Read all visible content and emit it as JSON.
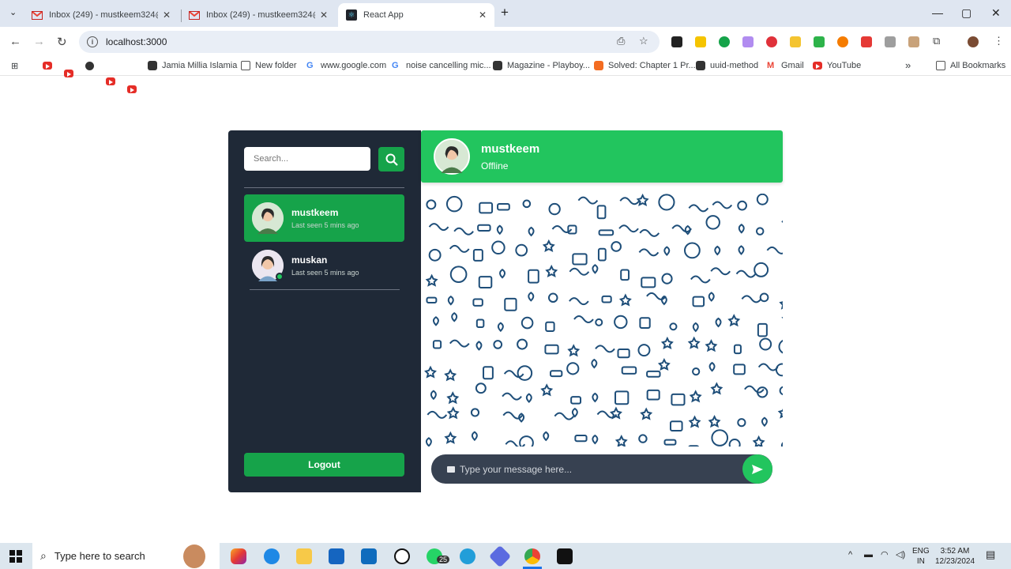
{
  "browser": {
    "tabs": [
      {
        "title": "Inbox (249) - mustkeem324@gm",
        "icon": "gmail-icon"
      },
      {
        "title": "Inbox (249) - mustkeem324@gm",
        "icon": "gmail-icon"
      },
      {
        "title": "React App",
        "icon": "react-icon"
      }
    ],
    "url": "localhost:3000",
    "bookmarks": [
      {
        "label": "Jamia Millia Islamia"
      },
      {
        "label": "New folder"
      },
      {
        "label": "www.google.com"
      },
      {
        "label": "noise cancelling mic..."
      },
      {
        "label": "Magazine - Playboy..."
      },
      {
        "label": "Solved: Chapter 1 Pr..."
      },
      {
        "label": "uuid-method"
      },
      {
        "label": "Gmail"
      },
      {
        "label": "YouTube"
      }
    ],
    "all_bookmarks": "All Bookmarks",
    "overflow": "»"
  },
  "sidebar": {
    "search_placeholder": "Search...",
    "contacts": [
      {
        "name": "mustkeem",
        "last_seen": "Last seen 5 mins ago",
        "active": true
      },
      {
        "name": "muskan",
        "last_seen": "Last seen 5 mins ago",
        "active": false,
        "online": true
      }
    ],
    "logout_label": "Logout"
  },
  "chat": {
    "name": "mustkeem",
    "status": "Offline",
    "message_placeholder": "Type your message here..."
  },
  "taskbar": {
    "search_placeholder": "Type here to search",
    "whatsapp_badge": "25",
    "lang_line1": "ENG",
    "lang_line2": "IN",
    "time": "3:52 AM",
    "date": "12/23/2024"
  },
  "colors": {
    "sidebar_bg": "#1f2937",
    "accent_green": "#22c55e",
    "button_green": "#16a34a",
    "input_bar": "#374151",
    "doodle": "#1e4e79"
  }
}
